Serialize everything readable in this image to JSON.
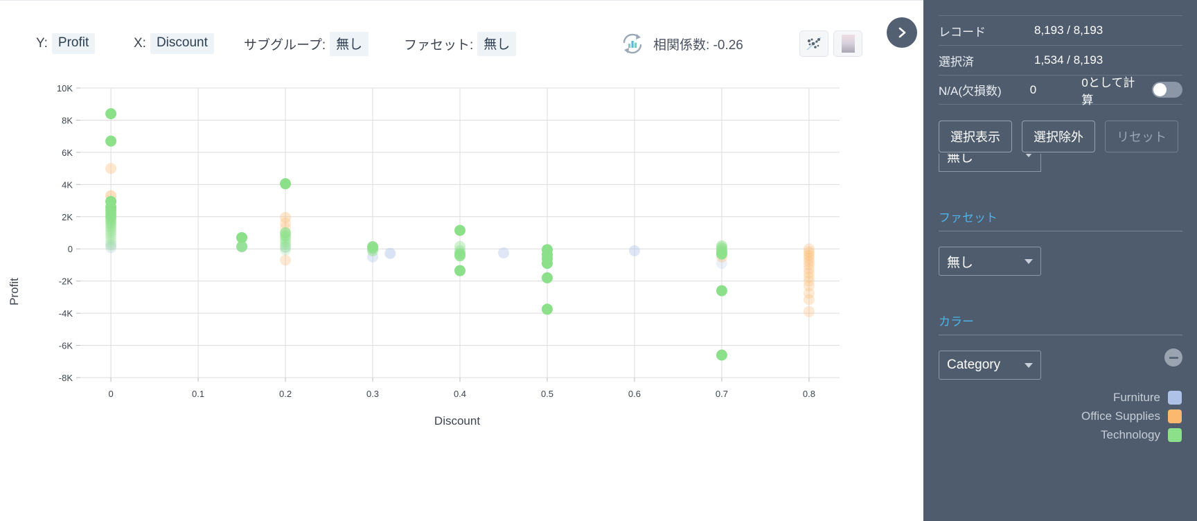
{
  "toolbar": {
    "y_label": "Y:",
    "y_value": "Profit",
    "x_label": "X:",
    "x_value": "Discount",
    "subgroup_label": "サブグループ:",
    "subgroup_value": "無し",
    "facet_label": "ファセット:",
    "facet_value": "無し",
    "correlation_text": "相関係数: -0.26",
    "refresh_icon": "refresh-chart-icon",
    "scatter_toggle_icon": "scatter-plot-icon",
    "heatmap_toggle_icon": "heatmap-gradient-icon",
    "expand_icon": "chevron-right-icon"
  },
  "sidebar": {
    "stats": [
      {
        "key": "レコード",
        "value": "8,193 / 8,193"
      },
      {
        "key": "選択済",
        "value": "1,534 / 8,193"
      }
    ],
    "na_row": {
      "key": "N/A(欠損数)",
      "value": "0",
      "toggle_label": "0として計算",
      "toggle_on": false
    },
    "actions": [
      {
        "label": "選択表示",
        "disabled": false
      },
      {
        "label": "選択除外",
        "disabled": false
      },
      {
        "label": "リセット",
        "disabled": true
      }
    ],
    "subgroup_cut_value": "無し",
    "facet": {
      "title": "ファセット",
      "value": "無し"
    },
    "color": {
      "title": "カラー",
      "value": "Category",
      "remove_icon": "minus-circle-icon"
    },
    "legend": [
      {
        "label": "Furniture",
        "color": "#aec2e8"
      },
      {
        "label": "Office Supplies",
        "color": "#fbb96f"
      },
      {
        "label": "Technology",
        "color": "#8ce08a"
      }
    ]
  },
  "chart_data": {
    "type": "scatter",
    "title": "",
    "xlabel": "Discount",
    "ylabel": "Profit",
    "xlim": [
      -0.035,
      0.835
    ],
    "ylim": [
      -8000,
      10000
    ],
    "xticks": [
      "0",
      "0.1",
      "0.2",
      "0.3",
      "0.4",
      "0.5",
      "0.6",
      "0.7",
      "0.8"
    ],
    "xtick_values": [
      0,
      0.1,
      0.2,
      0.3,
      0.4,
      0.5,
      0.6,
      0.7,
      0.8
    ],
    "yticks": [
      "10K",
      "8K",
      "6K",
      "4K",
      "2K",
      "0",
      "-2K",
      "-4K",
      "-6K",
      "-8K"
    ],
    "ytick_values": [
      10000,
      8000,
      6000,
      4000,
      2000,
      0,
      -2000,
      -4000,
      -6000,
      -8000
    ],
    "grid": true,
    "legend_position": "sidebar",
    "correlation": -0.26,
    "series": [
      {
        "name": "Furniture",
        "color": "#aec2e8",
        "points": [
          {
            "x": 0.0,
            "y": 250,
            "o": 0.25
          },
          {
            "x": 0.0,
            "y": 60,
            "o": 0.2
          },
          {
            "x": 0.15,
            "y": 120,
            "o": 0.45
          },
          {
            "x": 0.2,
            "y": 90,
            "o": 0.3
          },
          {
            "x": 0.3,
            "y": 20,
            "o": 0.4
          },
          {
            "x": 0.32,
            "y": -280,
            "o": 0.45
          },
          {
            "x": 0.3,
            "y": -500,
            "o": 0.35
          },
          {
            "x": 0.4,
            "y": -180,
            "o": 0.25
          },
          {
            "x": 0.4,
            "y": -1350,
            "o": 0.3
          },
          {
            "x": 0.45,
            "y": -250,
            "o": 0.4
          },
          {
            "x": 0.5,
            "y": -100,
            "o": 0.3
          },
          {
            "x": 0.5,
            "y": -700,
            "o": 0.25
          },
          {
            "x": 0.6,
            "y": -120,
            "o": 0.4
          },
          {
            "x": 0.7,
            "y": -200,
            "o": 0.3
          },
          {
            "x": 0.7,
            "y": -900,
            "o": 0.25
          }
        ]
      },
      {
        "name": "Office Supplies",
        "color": "#fbb96f",
        "points": [
          {
            "x": 0.0,
            "y": 5000,
            "o": 0.35
          },
          {
            "x": 0.0,
            "y": 3300,
            "o": 0.45
          },
          {
            "x": 0.0,
            "y": 2750,
            "o": 0.2
          },
          {
            "x": 0.2,
            "y": 1950,
            "o": 0.35
          },
          {
            "x": 0.2,
            "y": 1600,
            "o": 0.3
          },
          {
            "x": 0.2,
            "y": 1300,
            "o": 0.25
          },
          {
            "x": 0.2,
            "y": -700,
            "o": 0.3
          },
          {
            "x": 0.7,
            "y": -500,
            "o": 0.35
          },
          {
            "x": 0.8,
            "y": 0,
            "o": 0.3
          },
          {
            "x": 0.8,
            "y": -200,
            "o": 0.35
          },
          {
            "x": 0.8,
            "y": -400,
            "o": 0.35
          },
          {
            "x": 0.8,
            "y": -600,
            "o": 0.3
          },
          {
            "x": 0.8,
            "y": -800,
            "o": 0.3
          },
          {
            "x": 0.8,
            "y": -1000,
            "o": 0.3
          },
          {
            "x": 0.8,
            "y": -1250,
            "o": 0.3
          },
          {
            "x": 0.8,
            "y": -1500,
            "o": 0.3
          },
          {
            "x": 0.8,
            "y": -1750,
            "o": 0.28
          },
          {
            "x": 0.8,
            "y": -2000,
            "o": 0.28
          },
          {
            "x": 0.8,
            "y": -2300,
            "o": 0.3
          },
          {
            "x": 0.8,
            "y": -2750,
            "o": 0.3
          },
          {
            "x": 0.8,
            "y": -3150,
            "o": 0.3
          },
          {
            "x": 0.8,
            "y": -3900,
            "o": 0.3
          }
        ]
      },
      {
        "name": "Technology",
        "color": "#8ce08a",
        "points": [
          {
            "x": 0.0,
            "y": 8400,
            "o": 1.0
          },
          {
            "x": 0.0,
            "y": 6700,
            "o": 1.0
          },
          {
            "x": 0.0,
            "y": 2950,
            "o": 1.0
          },
          {
            "x": 0.0,
            "y": 2600,
            "o": 0.95
          },
          {
            "x": 0.0,
            "y": 2400,
            "o": 0.9
          },
          {
            "x": 0.0,
            "y": 2200,
            "o": 0.8
          },
          {
            "x": 0.0,
            "y": 2050,
            "o": 0.7
          },
          {
            "x": 0.0,
            "y": 1900,
            "o": 0.6
          },
          {
            "x": 0.0,
            "y": 1750,
            "o": 0.55
          },
          {
            "x": 0.0,
            "y": 1600,
            "o": 0.45
          },
          {
            "x": 0.0,
            "y": 1450,
            "o": 0.4
          },
          {
            "x": 0.0,
            "y": 1300,
            "o": 0.35
          },
          {
            "x": 0.0,
            "y": 1150,
            "o": 0.3
          },
          {
            "x": 0.0,
            "y": 1000,
            "o": 0.28
          },
          {
            "x": 0.0,
            "y": 850,
            "o": 0.25
          },
          {
            "x": 0.0,
            "y": 700,
            "o": 0.22
          },
          {
            "x": 0.0,
            "y": 550,
            "o": 0.2
          },
          {
            "x": 0.0,
            "y": 400,
            "o": 0.18
          },
          {
            "x": 0.0,
            "y": 250,
            "o": 0.16
          },
          {
            "x": 0.0,
            "y": 120,
            "o": 0.15
          },
          {
            "x": 0.15,
            "y": 700,
            "o": 1.0
          },
          {
            "x": 0.15,
            "y": 150,
            "o": 0.85
          },
          {
            "x": 0.2,
            "y": 4050,
            "o": 1.0
          },
          {
            "x": 0.2,
            "y": 1000,
            "o": 0.7
          },
          {
            "x": 0.2,
            "y": 800,
            "o": 0.55
          },
          {
            "x": 0.2,
            "y": 600,
            "o": 0.4
          },
          {
            "x": 0.2,
            "y": 430,
            "o": 0.35
          },
          {
            "x": 0.2,
            "y": 280,
            "o": 0.3
          },
          {
            "x": 0.2,
            "y": 120,
            "o": 0.25
          },
          {
            "x": 0.2,
            "y": -60,
            "o": 0.25
          },
          {
            "x": 0.3,
            "y": 140,
            "o": 0.9
          },
          {
            "x": 0.3,
            "y": 40,
            "o": 0.6
          },
          {
            "x": 0.3,
            "y": -120,
            "o": 0.5
          },
          {
            "x": 0.4,
            "y": 1150,
            "o": 1.0
          },
          {
            "x": 0.4,
            "y": 150,
            "o": 0.4
          },
          {
            "x": 0.4,
            "y": -100,
            "o": 0.35
          },
          {
            "x": 0.4,
            "y": -300,
            "o": 0.8
          },
          {
            "x": 0.4,
            "y": -430,
            "o": 0.85
          },
          {
            "x": 0.4,
            "y": -1350,
            "o": 1.0
          },
          {
            "x": 0.5,
            "y": -50,
            "o": 1.0
          },
          {
            "x": 0.5,
            "y": -350,
            "o": 1.0
          },
          {
            "x": 0.5,
            "y": -600,
            "o": 1.0
          },
          {
            "x": 0.5,
            "y": -900,
            "o": 1.0
          },
          {
            "x": 0.5,
            "y": -1800,
            "o": 1.0
          },
          {
            "x": 0.5,
            "y": -3750,
            "o": 1.0
          },
          {
            "x": 0.7,
            "y": 180,
            "o": 0.55
          },
          {
            "x": 0.7,
            "y": 60,
            "o": 0.5
          },
          {
            "x": 0.7,
            "y": -60,
            "o": 0.5
          },
          {
            "x": 0.7,
            "y": -180,
            "o": 0.6
          },
          {
            "x": 0.7,
            "y": -320,
            "o": 0.95
          },
          {
            "x": 0.7,
            "y": -2600,
            "o": 1.0
          },
          {
            "x": 0.7,
            "y": -6600,
            "o": 1.0
          }
        ]
      }
    ]
  }
}
